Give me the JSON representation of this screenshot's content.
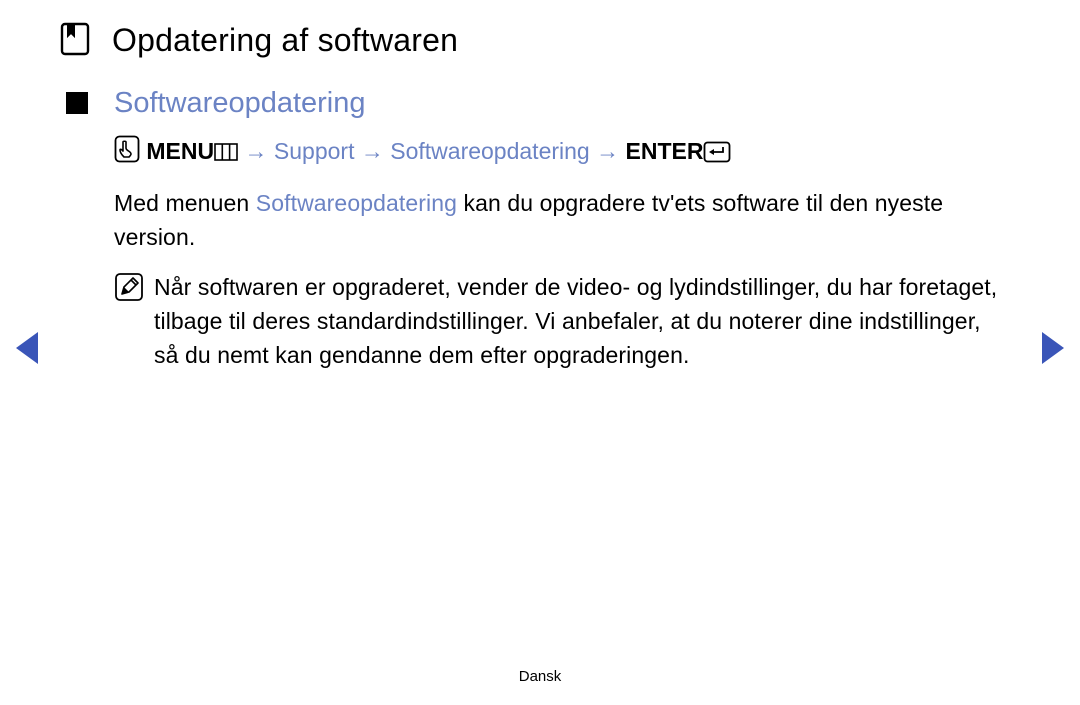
{
  "title": "Opdatering af softwaren",
  "section_title": "Softwareopdatering",
  "nav": {
    "menu_label": "MENU",
    "arrow1": " → ",
    "support": "Support",
    "arrow2": " → ",
    "swupdate": "Softwareopdatering",
    "arrow3": " → ",
    "enter_label": "ENTER"
  },
  "body": {
    "prefix": "Med menuen ",
    "highlight": "Softwareopdatering",
    "suffix": " kan du opgradere tv'ets software til den nyeste version."
  },
  "note": "Når softwaren er opgraderet, vender de video- og lydindstillinger, du har foretaget, tilbage til deres standardindstillinger. Vi anbefaler, at du noterer dine indstillinger, så du nemt kan gendanne dem efter opgraderingen.",
  "footer": "Dansk"
}
